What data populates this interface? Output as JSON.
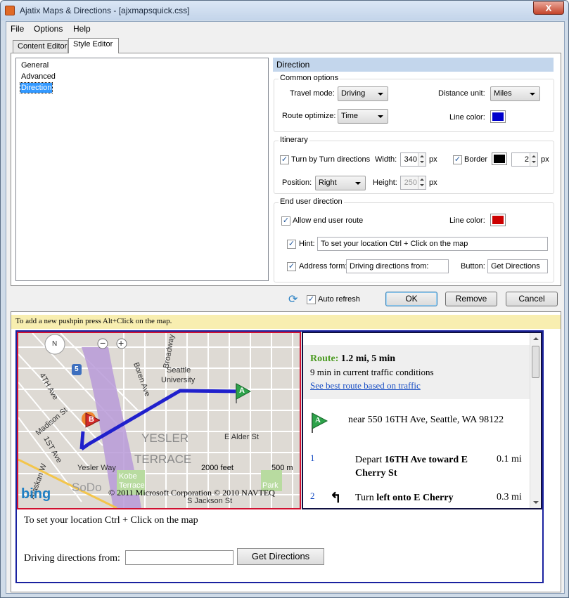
{
  "window": {
    "title": "Ajatix Maps & Directions - [ajxmapsquick.css]",
    "close_glyph": "X"
  },
  "menu": [
    "File",
    "Options",
    "Help"
  ],
  "tabs": [
    "Content Editor",
    "Style Editor"
  ],
  "sidebar": {
    "items": [
      "General",
      "Advanced",
      "Direction"
    ],
    "selected": "Direction"
  },
  "section_title": "Direction",
  "common": {
    "label": "Common options",
    "travel_mode_label": "Travel mode:",
    "travel_mode": "Driving",
    "distance_unit_label": "Distance unit:",
    "distance_unit": "Miles",
    "route_optimize_label": "Route optimize:",
    "route_optimize": "Time",
    "line_color_label": "Line color:",
    "line_color": "#0000cc"
  },
  "itinerary": {
    "label": "Itinerary",
    "turn_by_turn": "Turn by Turn directions",
    "turn_by_turn_checked": true,
    "width_label": "Width:",
    "width": "340",
    "unit_px": "px",
    "border_label": "Border",
    "border_checked": true,
    "border_color": "#000000",
    "border_width": "2",
    "position_label": "Position:",
    "position": "Right",
    "height_label": "Height:",
    "height": "250"
  },
  "end_user": {
    "label": "End user direction",
    "allow_route": "Allow end user route",
    "allow_route_checked": true,
    "line_color_label": "Line color:",
    "line_color": "#cc0000",
    "hint_label": "Hint:",
    "hint_checked": true,
    "hint_value": "To set your location Ctrl + Click on the map",
    "address_form_label": "Address form:",
    "address_form_checked": true,
    "address_form_value": "Driving directions from:",
    "button_label": "Button:",
    "button_value": "Get Directions"
  },
  "actions": {
    "auto_refresh": "Auto refresh",
    "auto_refresh_checked": true,
    "ok": "OK",
    "remove": "Remove",
    "cancel": "Cancel"
  },
  "preview": {
    "hint_bar": "To add a new pushpin press Alt+Click on the map.",
    "map": {
      "labels": [
        "Seattle",
        "University",
        "YESLER",
        "TERRACE",
        "Yesler Way",
        "E Alder St",
        "Madison St",
        "4TH Ave",
        "1ST Ave",
        "Boren Ave",
        "Broadway",
        "Kobe",
        "Terrace",
        "Park",
        "S Jackson St",
        "SoDo",
        "Alaskan W"
      ],
      "scale_feet": "2000 feet",
      "scale_m": "500 m",
      "copyright": "© 2011 Microsoft Corporation   © 2010 NAVTEQ",
      "logo": "bing",
      "compass": "N",
      "highway": "5",
      "pin_a": "A",
      "pin_b": "B"
    },
    "directions": {
      "route_label": "Route:",
      "route_value": "1.2 mi, 5 min",
      "traffic": "9 min in current traffic conditions",
      "best_route_link": "See best route based on traffic",
      "start_address": "near 550 16TH Ave, Seattle, WA 98122",
      "steps": [
        {
          "num": "1",
          "text_plain": "Depart ",
          "text_bold": "16TH Ave toward E Cherry St",
          "dist": "0.1 mi"
        },
        {
          "num": "2",
          "text_plain": "Turn ",
          "text_bold": "left onto E Cherry",
          "dist": "0.3 mi"
        }
      ]
    },
    "form": {
      "hint": "To set your location Ctrl + Click on the map",
      "label": "Driving directions from:",
      "button": "Get Directions"
    }
  },
  "colors": {
    "route_line": "#2020cc",
    "pin_green": "#2da34a",
    "pin_red": "#d22a2a"
  }
}
